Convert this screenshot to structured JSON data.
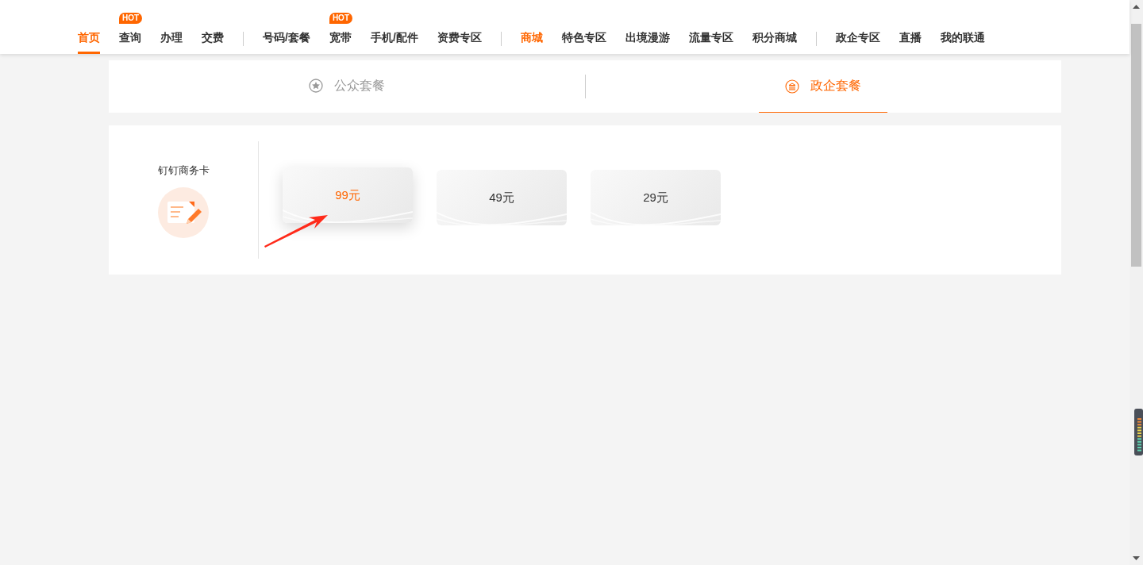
{
  "nav": {
    "groups": [
      {
        "items": [
          {
            "label": "首页",
            "selected": true,
            "highlighted": false
          },
          {
            "label": "查询",
            "selected": false,
            "highlighted": false,
            "badge": "HOT"
          },
          {
            "label": "办理",
            "selected": false,
            "highlighted": false
          },
          {
            "label": "交费",
            "selected": false,
            "highlighted": false
          }
        ]
      },
      {
        "items": [
          {
            "label": "号码/套餐",
            "selected": false,
            "highlighted": false
          },
          {
            "label": "宽带",
            "selected": false,
            "highlighted": false,
            "badge": "HOT"
          },
          {
            "label": "手机/配件",
            "selected": false,
            "highlighted": false
          },
          {
            "label": "资费专区",
            "selected": false,
            "highlighted": false
          }
        ]
      },
      {
        "items": [
          {
            "label": "商城",
            "selected": false,
            "highlighted": true
          },
          {
            "label": "特色专区",
            "selected": false,
            "highlighted": false
          },
          {
            "label": "出境漫游",
            "selected": false,
            "highlighted": false
          },
          {
            "label": "流量专区",
            "selected": false,
            "highlighted": false
          },
          {
            "label": "积分商城",
            "selected": false,
            "highlighted": false
          }
        ]
      },
      {
        "items": [
          {
            "label": "政企专区",
            "selected": false,
            "highlighted": false
          },
          {
            "label": "直播",
            "selected": false,
            "highlighted": false
          },
          {
            "label": "我的联通",
            "selected": false,
            "highlighted": false
          }
        ]
      }
    ]
  },
  "tabs": [
    {
      "label": "公众套餐",
      "kind": "star",
      "selected": false
    },
    {
      "label": "政企套餐",
      "kind": "bank",
      "selected": true
    }
  ],
  "category": {
    "title": "钉钉商务卡"
  },
  "plans": [
    {
      "price": "99元",
      "selected": true
    },
    {
      "price": "49元",
      "selected": false
    },
    {
      "price": "29元",
      "selected": false
    }
  ]
}
